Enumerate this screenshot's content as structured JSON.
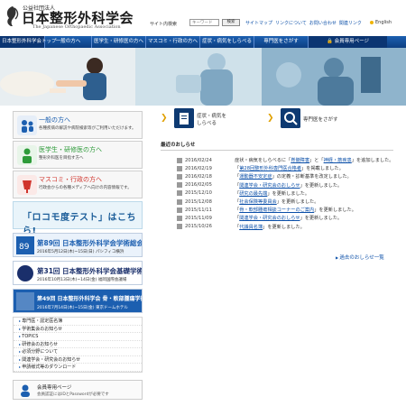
{
  "header": {
    "org_sub": "公益社団法人",
    "org_name": "日本整形外科学会",
    "org_en": "The Japanese Orthopaedic Association",
    "search_label": "サイト内検索",
    "search_placeholder": "キーワード",
    "search_button": "検索",
    "util_links": [
      "サイトマップ",
      "リンクについて",
      "お問い合わせ",
      "関連リンク"
    ],
    "lang": "English",
    "accent": "#1c5fb0"
  },
  "nav": {
    "home": "日本整形外科学会トップ",
    "items": [
      "一般の方へ",
      "医学生・研修医の方へ",
      "マスコミ・行政の方へ",
      "症状・病気をしらべる",
      "専門医をさがす"
    ],
    "member": "会員専用ページ"
  },
  "sidebar": {
    "categories": [
      {
        "title": "一般の方へ",
        "desc": "各種疾病の解説や病院検索等がご利用いただけます。",
        "color": "#1c5fb0"
      },
      {
        "title": "医学生・研修医の方へ",
        "desc": "整形外科医を目指す方へ",
        "color": "#2e9b3a"
      },
      {
        "title": "マスコミ・行政の方へ",
        "desc": "行政会からの各種メディアへ向けの内容情報です。",
        "color": "#d0342c"
      }
    ],
    "locomo": "「ロコモ度テスト」はこちら!",
    "banners": [
      {
        "title": "第89回 日本整形外科学会学術総会",
        "sub": "2016年5月12日(木)~15日(日) パシフィコ横浜",
        "color": "#1c5fb0",
        "bg": "#eaf2fb"
      },
      {
        "title": "第31回 日本整形外科学会基礎学術集会",
        "sub": "2016年10月13日(木)~14日(金) 福岡国際会議場",
        "color": "#1a2f6b",
        "bg": "#ffffff"
      },
      {
        "title": "第49回 日本整形外科学会 骨・軟部腫瘍学術集会",
        "sub": "2016年7月14日(木)~15日(金) 東京ドームホテル",
        "color": "#ffffff",
        "bg": "#1c5fb0"
      }
    ],
    "links": [
      "専門医・認定医名簿",
      "学術集会のお知らせ",
      "TOPICS",
      "研修会のお知らせ",
      "必須分野について",
      "関連学会・研究会のお知らせ",
      "申請様式等のダウンロード"
    ],
    "member_box": {
      "title": "会員専用ページ",
      "sub": "会員認証にはIDとPasswordが必要です"
    }
  },
  "quick": {
    "disease": [
      "症状・病気を",
      "しらべる"
    ],
    "doctor": "専門医をさがす"
  },
  "news": {
    "heading": "最近のおしらせ",
    "items": [
      {
        "date": "2016/02/24",
        "pre": "症状・病気をしらべるに「",
        "link": "脊髄障害",
        "mid": "」と「",
        "link2": "神経・筋疾患",
        "post": "」を追加しました。"
      },
      {
        "date": "2016/02/19",
        "pre": "「",
        "link": "第28回整形外科専門医合格者",
        "mid": "",
        "link2": "",
        "post": "」を掲載しました。"
      },
      {
        "date": "2016/02/18",
        "pre": "「",
        "link": "運動器不安定症",
        "mid": "",
        "link2": "",
        "post": "」の定義・診断基準を改定しました。"
      },
      {
        "date": "2016/02/05",
        "pre": "「",
        "link": "関連学会・研究会のおしらせ",
        "mid": "",
        "link2": "",
        "post": "」を更新しました。"
      },
      {
        "date": "2015/12/10",
        "pre": "「",
        "link": "研究の最先端",
        "mid": "",
        "link2": "",
        "post": "」を更新しました。"
      },
      {
        "date": "2015/12/08",
        "pre": "「",
        "link": "社会保険等委員会",
        "mid": "",
        "link2": "",
        "post": "」を更新しました。"
      },
      {
        "date": "2015/11/11",
        "pre": "「",
        "link": "骨・軟部腫瘍相談コーナーのご案内",
        "mid": "",
        "link2": "",
        "post": "」を更新しました。"
      },
      {
        "date": "2015/11/09",
        "pre": "「",
        "link": "関連学会・研究会のおしらせ",
        "mid": "",
        "link2": "",
        "post": "」を更新しました。"
      },
      {
        "date": "2015/10/26",
        "pre": "「",
        "link": "代議員名簿",
        "mid": "",
        "link2": "",
        "post": "」を更新しました。"
      }
    ],
    "past_link": "過去のおしらせ一覧"
  }
}
